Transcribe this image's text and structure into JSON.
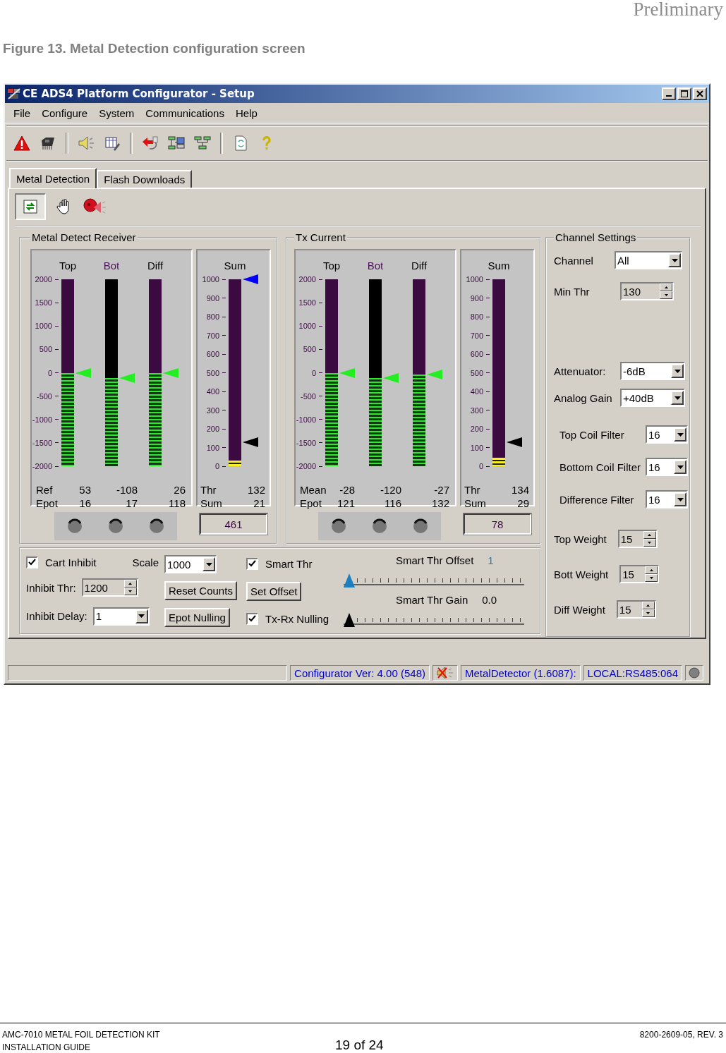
{
  "page": {
    "stamp": "Preliminary",
    "caption": "Figure 13. Metal Detection configuration screen",
    "footer": {
      "left": [
        "AMC-7010 METAL FOIL DETECTION KIT",
        "INSTALLATION GUIDE"
      ],
      "center": "19 of 24",
      "right": "8200-2609-05, REV. 3"
    }
  },
  "window": {
    "title": "CE ADS4 Platform Configurator - Setup"
  },
  "menu": [
    "File",
    "Configure",
    "System",
    "Communications",
    "Help"
  ],
  "tabs": [
    {
      "label": "Metal Detection",
      "selected": true
    },
    {
      "label": "Flash Downloads",
      "selected": false
    }
  ],
  "meter_panels": [
    {
      "title": "Metal Detect Receiver",
      "ticks": [
        "2000",
        "1500",
        "1000",
        "500",
        "0",
        "-500",
        "-1000",
        "-1500",
        "-2000"
      ],
      "meters": [
        {
          "label": "Top",
          "kind": "primary",
          "color": "#000000",
          "level": 0.5
        },
        {
          "label": "Bot",
          "kind": "secondary",
          "color": "#4a1456",
          "level": 0.47
        },
        {
          "label": "Diff",
          "kind": "primary",
          "color": "#000000",
          "level": 0.5
        }
      ],
      "readings": [
        [
          "Ref",
          "53",
          "-108",
          "26"
        ],
        [
          "Epot",
          "16",
          "17",
          "118"
        ]
      ],
      "sum": {
        "label": "Sum",
        "ticks": [
          "1000",
          "900",
          "800",
          "700",
          "600",
          "500",
          "400",
          "300",
          "200",
          "100",
          "0"
        ],
        "level": 0.03,
        "markers": [
          {
            "level": 1,
            "color": "#0000ff"
          },
          {
            "level": 0.13,
            "color": "#000000"
          }
        ],
        "readings": [
          [
            "Thr",
            "132"
          ],
          [
            "Sum",
            "21"
          ]
        ],
        "total": "461"
      }
    },
    {
      "title": "Tx Current",
      "ticks": [
        "2000",
        "1500",
        "1000",
        "500",
        "0",
        "-500",
        "-1000",
        "-1500",
        "-2000"
      ],
      "meters": [
        {
          "label": "Top",
          "kind": "primary",
          "color": "#000000",
          "level": 0.5
        },
        {
          "label": "Bot",
          "kind": "secondary",
          "color": "#4a1456",
          "level": 0.47
        },
        {
          "label": "Diff",
          "kind": "primary",
          "color": "#000000",
          "level": 0.49
        }
      ],
      "readings": [
        [
          "Mean",
          "-28",
          "-120",
          "-27"
        ],
        [
          "Epot",
          "121",
          "116",
          "132"
        ]
      ],
      "sum": {
        "label": "Sum",
        "ticks": [
          "1000",
          "900",
          "800",
          "700",
          "600",
          "500",
          "400",
          "300",
          "200",
          "100",
          "0"
        ],
        "level": 0.045,
        "markers": [
          {
            "level": 0.13,
            "color": "#000000"
          }
        ],
        "readings": [
          [
            "Thr",
            "134"
          ],
          [
            "Sum",
            "29"
          ]
        ],
        "total": "78"
      }
    }
  ],
  "channel_settings": {
    "title": "Channel Settings",
    "groups": [
      [
        {
          "kind": "dropdown",
          "label": "Channel",
          "value": "All"
        },
        {
          "kind": "spinner",
          "label": "Min Thr",
          "value": "130"
        }
      ],
      [
        {
          "kind": "dropdown",
          "label": "Attenuator:",
          "value": "-6dB"
        },
        {
          "kind": "dropdown",
          "label": "Analog Gain",
          "value": "+40dB"
        }
      ],
      [
        {
          "kind": "dropdown",
          "label": "Top Coil Filter",
          "value": "16"
        },
        {
          "kind": "dropdown",
          "label": "Bottom Coil Filter",
          "value": "16"
        },
        {
          "kind": "dropdown",
          "label": "Difference Filter",
          "value": "16"
        }
      ],
      [
        {
          "kind": "spinner",
          "label": "Top Weight",
          "value": "15"
        },
        {
          "kind": "spinner",
          "label": "Bott Weight",
          "value": "15"
        },
        {
          "kind": "spinner",
          "label": "Diff Weight",
          "value": "15"
        }
      ]
    ]
  },
  "options": {
    "cart_inhibit": {
      "label": "Cart Inhibit",
      "checked": true
    },
    "scale": {
      "label": "Scale",
      "value": "1000"
    },
    "inhibit_thr": {
      "label": "Inhibit Thr:",
      "value": "1200"
    },
    "inhibit_delay": {
      "label": "Inhibit Delay:",
      "value": "1"
    },
    "buttons": [
      "Reset Counts",
      "Epot Nulling"
    ],
    "smart_thr": {
      "label": "Smart Thr",
      "checked": true
    },
    "set_offset": "Set Offset",
    "tx_rx_nulling": {
      "label": "Tx-Rx Nulling",
      "checked": true
    },
    "sliders": [
      {
        "label": "Smart Thr Offset",
        "value": "1",
        "level": 0,
        "color": "#1e7fc0"
      },
      {
        "label": "Smart Thr Gain",
        "value": "0.0",
        "level": 0,
        "color": "#000000"
      }
    ]
  },
  "status_bar": [
    {
      "kind": "empty"
    },
    {
      "kind": "text",
      "text": "Configurator Ver: 4.00 (548)"
    },
    {
      "kind": "icon"
    },
    {
      "kind": "text",
      "text": "MetalDetector (1.6087):"
    },
    {
      "kind": "text",
      "text": "LOCAL:RS485:064"
    },
    {
      "kind": "light"
    }
  ]
}
